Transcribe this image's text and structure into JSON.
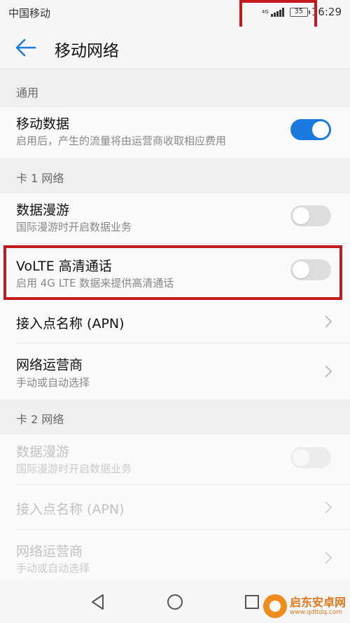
{
  "status_bar": {
    "carrier": "中国移动",
    "network": "4G",
    "battery": "35",
    "time": "16:29"
  },
  "app_bar": {
    "title": "移动网络",
    "back_icon": "arrow-left-icon"
  },
  "sections": {
    "general": {
      "header": "通用"
    },
    "sim1": {
      "header": "卡 1 网络"
    },
    "sim2": {
      "header": "卡 2 网络"
    }
  },
  "rows": {
    "mobile_data": {
      "title": "移动数据",
      "subtitle": "启用后，产生的流量将由运营商收取相应费用",
      "enabled": true
    },
    "sim1_roaming": {
      "title": "数据漫游",
      "subtitle": "国际漫游时开启数据业务",
      "enabled": false
    },
    "sim1_volte": {
      "title": "VoLTE 高清通话",
      "subtitle": "启用 4G LTE 数据来提供高清通话",
      "enabled": false
    },
    "sim1_apn": {
      "title": "接入点名称 (APN)"
    },
    "sim1_operator": {
      "title": "网络运营商",
      "subtitle": "手动或自动选择"
    },
    "sim2_roaming": {
      "title": "数据漫游",
      "subtitle": "国际漫游时开启数据业务",
      "enabled": false,
      "disabled": true
    },
    "sim2_apn": {
      "title": "接入点名称 (APN)",
      "disabled": true
    },
    "sim2_operator": {
      "title": "网络运营商",
      "subtitle": "手动或自动选择",
      "disabled": true
    }
  },
  "nav_bar": {
    "back": "triangle-back-icon",
    "home": "circle-home-icon",
    "recents": "square-recents-icon"
  },
  "watermark": {
    "title": "启东安卓网",
    "url": "www.qdltdq.com"
  },
  "colors": {
    "accent": "#1a7ae0",
    "highlight_box": "#c41a1a",
    "background": "#f1f1f3"
  }
}
